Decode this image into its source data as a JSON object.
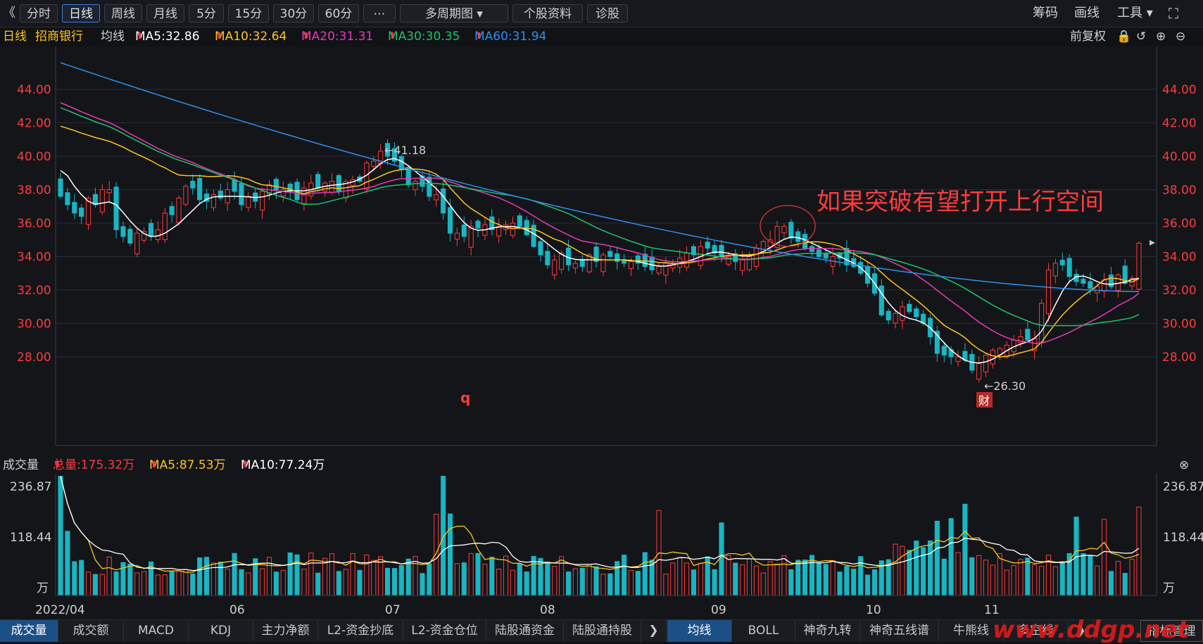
{
  "toolbar": {
    "collapse": "《",
    "periods": [
      "分时",
      "日线",
      "周线",
      "月线",
      "5分",
      "15分",
      "30分",
      "60分",
      "⋯"
    ],
    "active_period": "日线",
    "multi": "多周期图",
    "profile": "个股资料",
    "diagnose": "诊股",
    "right": [
      "筹码",
      "画线",
      "工具"
    ]
  },
  "ma_bar": {
    "period": "日线",
    "stock": "招商银行",
    "label": "均线",
    "ma5": "MA5:32.86",
    "ma10": "MA10:32.64",
    "ma20": "MA20:31.31",
    "ma30": "MA30:30.35",
    "ma60": "MA60:31.94",
    "adjust": "前复权"
  },
  "colors": {
    "up": "#ff3b3b",
    "down": "#19b5c2",
    "ma5": "#ffffff",
    "ma10": "#ffc51a",
    "ma20": "#e83ab4",
    "ma30": "#1bc46b",
    "ma60": "#2f8ff0"
  },
  "price_axis": [
    "44.00",
    "42.00",
    "40.00",
    "38.00",
    "36.00",
    "34.00",
    "32.00",
    "30.00",
    "28.00"
  ],
  "annotations": {
    "high": "←41.18",
    "low": "←26.30",
    "note": "如果突破有望打开上行空间",
    "q_marker": "q",
    "cai": "财"
  },
  "volume_bar": {
    "label": "成交量",
    "total": "总量:175.32万",
    "ma5": "MA5:87.53万",
    "ma10": "MA10:77.24万"
  },
  "volume_axis": [
    "236.87",
    "118.44",
    "万"
  ],
  "x_axis": [
    "2022/04",
    "06",
    "07",
    "08",
    "09",
    "10",
    "11"
  ],
  "tabs_left": [
    "成交量",
    "成交额",
    "MACD",
    "KDJ",
    "主力净额",
    "L2-资金抄底",
    "L2-资金仓位",
    "陆股通资金",
    "陆股通持股"
  ],
  "tabs_right": [
    "均线",
    "BOLL",
    "神奇九转",
    "神奇五线谱",
    "牛熊线",
    "多空线"
  ],
  "tab_manage": "指标管理",
  "watermark": "www.ddgp.net",
  "chart_data": {
    "type": "candlestick",
    "ylim": [
      25.5,
      46
    ],
    "closes": [
      37.6,
      37.1,
      36.6,
      36.4,
      37.5,
      37.1,
      38.0,
      38.0,
      35.6,
      35.2,
      34.8,
      35.4,
      35.5,
      35.2,
      35.6,
      36.6,
      36.5,
      37.5,
      38.2,
      38.1,
      37.4,
      37.3,
      37.7,
      37.5,
      38.0,
      37.9,
      37.1,
      37.6,
      37.3,
      37.9,
      38.3,
      38.0,
      38.0,
      37.9,
      37.4,
      38.1,
      38.4,
      38.1,
      38.4,
      38.5,
      37.9,
      38.5,
      38.6,
      38.5,
      39.6,
      39.7,
      40.3,
      40.0,
      39.7,
      39.2,
      38.3,
      38.5,
      38.2,
      37.6,
      37.7,
      36.6,
      35.4,
      35.4,
      35.2,
      35.8,
      35.7,
      35.9,
      35.6,
      35.8,
      35.9,
      36.0,
      35.8,
      35.3,
      34.6,
      34.1,
      33.5,
      33.8,
      34.2,
      33.5,
      33.6,
      33.4,
      34.1,
      33.7,
      34.1,
      34.0,
      33.7,
      33.6,
      33.7,
      33.6,
      33.4,
      33.2,
      33.4,
      33.6,
      33.6,
      33.9,
      34.2,
      34.1,
      34.6,
      34.5,
      34.2,
      34.0,
      34.0,
      33.7,
      33.8,
      34.0,
      34.5,
      34.9,
      35.0,
      35.8,
      35.8,
      35.1,
      34.9,
      34.5,
      34.3,
      34.0,
      33.9,
      34.0,
      33.9,
      33.5,
      33.4,
      33.0,
      32.4,
      31.8,
      30.5,
      30.2,
      30.6,
      31.0,
      30.7,
      30.4,
      30.0,
      29.2,
      28.2,
      28.1,
      28.0,
      28.0,
      27.8,
      27.2,
      27.6,
      28.1,
      28.4,
      28.5,
      28.7,
      29.0,
      29.2,
      29.0,
      29.1,
      31.2,
      33.2,
      33.6,
      33.5,
      32.8,
      32.5,
      32.4,
      32.1,
      32.2,
      32.6,
      32.2,
      32.9,
      32.4,
      32.7,
      34.8
    ],
    "ma5": [
      39.5,
      38.8,
      38.2,
      37.6,
      37.3,
      37.0,
      37.1,
      37.5,
      37.2,
      36.6,
      36.1,
      35.7,
      35.3,
      35.1,
      35.2,
      35.4,
      35.6,
      36.0,
      36.3,
      36.8,
      37.2,
      37.5,
      37.6,
      37.6,
      37.6,
      37.6,
      37.6,
      37.6,
      37.5,
      37.5,
      37.7,
      37.8,
      37.9,
      38.0,
      37.9,
      37.9,
      38.0,
      38.1,
      38.2,
      38.3,
      38.3,
      38.3,
      38.5,
      38.6,
      38.8,
      39.2,
      39.6,
      39.9,
      39.9,
      39.8,
      39.4,
      39.1,
      38.8,
      38.4,
      38.1,
      37.7,
      37.0,
      36.5,
      36.0,
      35.6,
      35.5,
      35.6,
      35.7,
      35.8,
      35.8,
      35.8,
      35.8,
      35.6,
      35.4,
      35.1,
      34.8,
      34.4,
      34.1,
      33.9,
      33.8,
      33.8,
      33.8,
      33.8,
      33.8,
      33.8,
      33.8,
      33.8,
      33.8,
      33.7,
      33.6,
      33.5,
      33.4,
      33.4,
      33.5,
      33.6,
      33.7,
      33.8,
      34.0,
      34.2,
      34.3,
      34.3,
      34.2,
      34.1,
      34.0,
      34.0,
      34.1,
      34.3,
      34.5,
      34.8,
      35.1,
      35.2,
      35.2,
      35.0,
      34.8,
      34.6,
      34.4,
      34.2,
      34.0,
      33.8,
      33.6,
      33.4,
      33.0,
      32.4,
      31.8,
      31.2,
      30.7,
      30.4,
      30.3,
      30.2,
      30.1,
      29.8,
      29.3,
      28.8,
      28.4,
      28.0,
      27.8,
      27.6,
      27.6,
      27.7,
      27.8,
      28.1,
      28.4,
      28.6,
      28.8,
      28.9,
      29.0,
      29.4,
      30.2,
      31.2,
      32.0,
      32.6,
      32.9,
      32.9,
      32.7,
      32.5,
      32.3,
      32.3,
      32.4,
      32.5,
      32.5,
      32.9
    ],
    "volume_ylim": [
      0,
      236.87
    ]
  }
}
